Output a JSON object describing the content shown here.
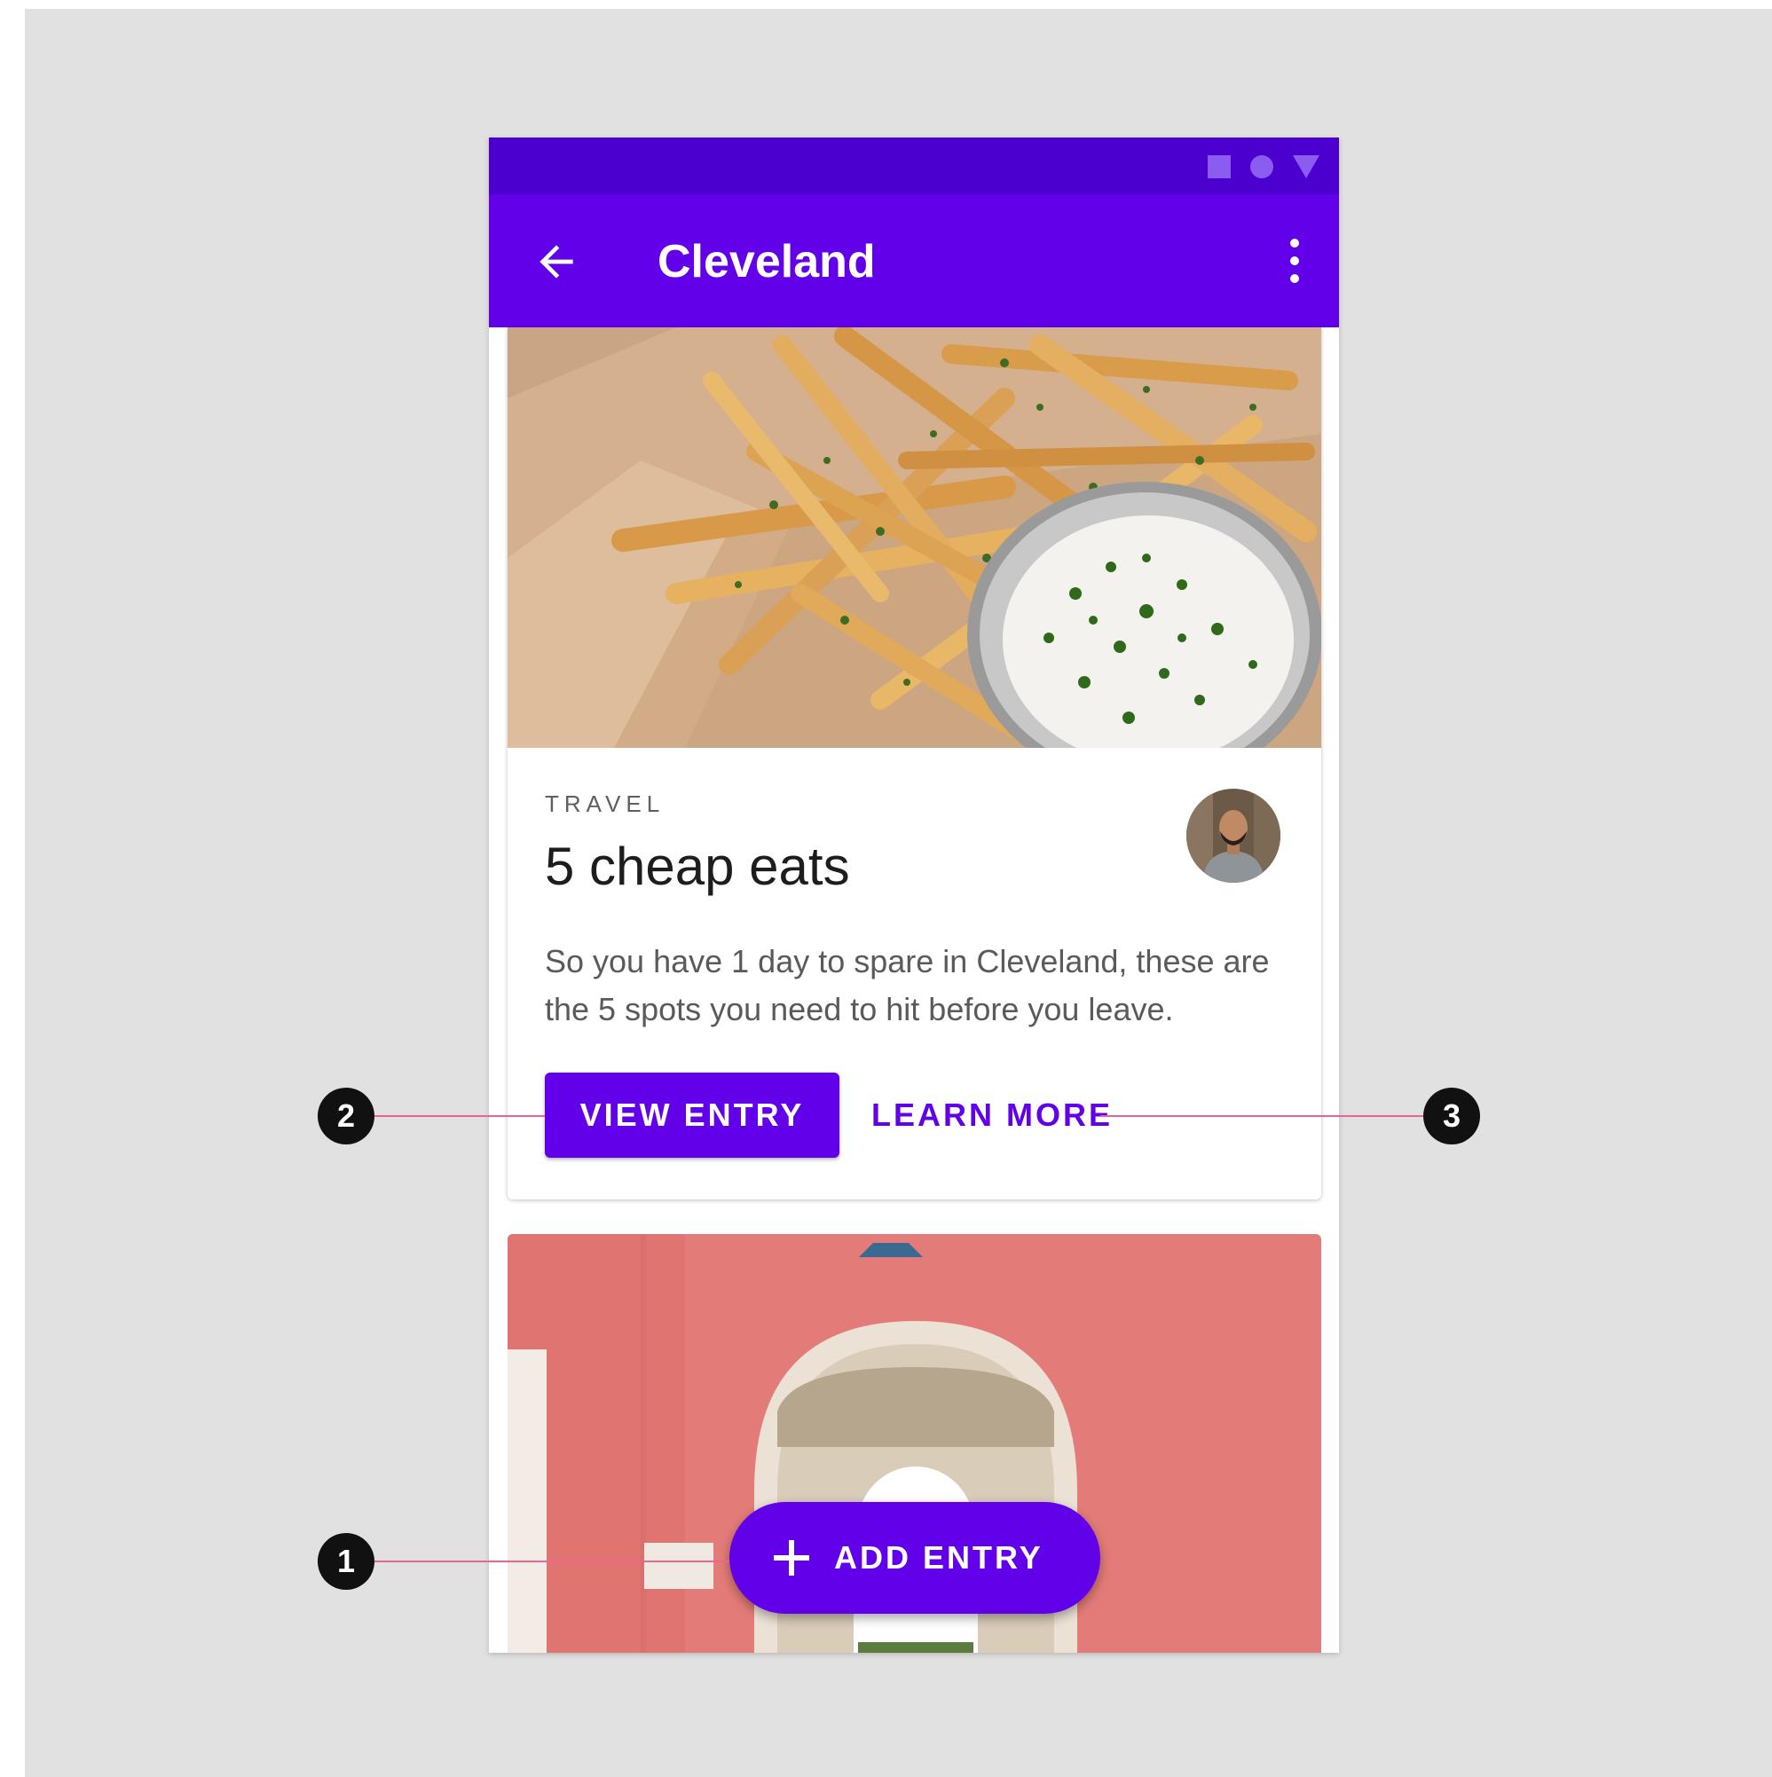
{
  "status_bar": {
    "icons": [
      "square-icon",
      "circle-icon",
      "triangle-icon"
    ],
    "color": "#4b00d0"
  },
  "app_bar": {
    "title": "Cleveland",
    "color": "#6200ea",
    "navigation_icon": "arrow-back-icon",
    "action_icon": "more-vert-icon"
  },
  "card": {
    "overline": "TRAVEL",
    "title": "5 cheap eats",
    "body": "So you have 1 day to spare in Cleveland, these are the 5 spots you need to hit before you leave.",
    "primary_button": "VIEW ENTRY",
    "secondary_button": "LEARN MORE"
  },
  "fab": {
    "label": "ADD ENTRY",
    "icon": "plus-icon"
  },
  "callouts": [
    {
      "number": "1",
      "target": "fab"
    },
    {
      "number": "2",
      "target": "primary_button"
    },
    {
      "number": "3",
      "target": "secondary_button"
    }
  ],
  "colors": {
    "primary": "#6200ea",
    "primary_variant": "#4b00d0",
    "callout_line": "#f06292",
    "background": "#e1e1e1"
  }
}
